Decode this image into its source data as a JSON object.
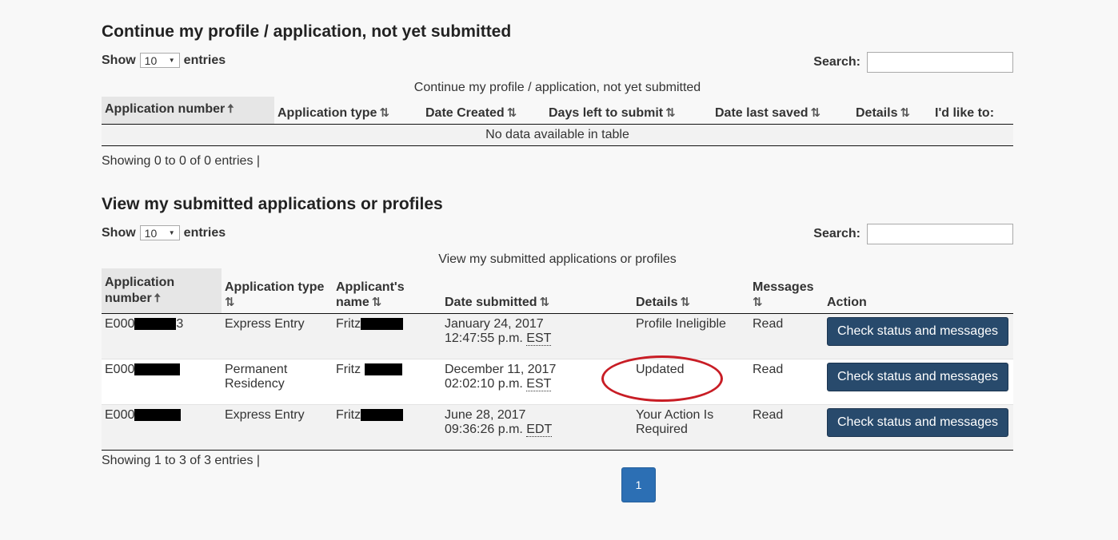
{
  "section1": {
    "title": "Continue my profile / application, not yet submitted",
    "show_label": "Show",
    "entries_label": "entries",
    "page_size": "10",
    "search_label": "Search:",
    "search_value": "",
    "caption": "Continue my profile / application, not yet submitted",
    "columns": [
      "Application number",
      "Application type",
      "Date Created",
      "Days left to submit",
      "Date last saved",
      "Details",
      "I'd like to:"
    ],
    "empty_message": "No data available in table",
    "info": "Showing 0 to 0 of 0 entries |"
  },
  "section2": {
    "title": "View my submitted applications or profiles",
    "show_label": "Show",
    "entries_label": "entries",
    "page_size": "10",
    "search_label": "Search:",
    "search_value": "",
    "caption": "View my submitted applications or profiles",
    "columns": {
      "app_number_1": "Application",
      "app_number_2": "number",
      "app_type": "Application type",
      "applicant_1": "Applicant's",
      "applicant_2": "name",
      "date_submitted": "Date submitted",
      "details": "Details",
      "messages": "Messages",
      "action": "Action"
    },
    "rows": [
      {
        "app_number_prefix": "E000",
        "app_number_suffix": "3",
        "app_type": "Express Entry",
        "applicant_name": "Fritz",
        "date": "January 24, 2017",
        "time": "12:47:55 p.m.",
        "tz": "EST",
        "details": "Profile Ineligible",
        "messages": "Read",
        "action": "Check status and messages"
      },
      {
        "app_number_prefix": "E000",
        "app_number_suffix": "",
        "app_type": "Permanent Residency",
        "applicant_name": "Fritz",
        "date": "December 11, 2017",
        "time": "02:02:10 p.m.",
        "tz": "EST",
        "details": "Updated",
        "messages": "Read",
        "action": "Check status and messages"
      },
      {
        "app_number_prefix": "E000",
        "app_number_suffix": "",
        "app_type": "Express Entry",
        "applicant_name": "Fritz",
        "date": "June 28, 2017",
        "time": "09:36:26 p.m.",
        "tz": "EDT",
        "details": "Your Action Is Required",
        "messages": "Read",
        "action": "Check status and messages"
      }
    ],
    "info": "Showing 1 to 3 of 3 entries |",
    "current_page": "1"
  },
  "icons": {
    "sort_asc": "arrow-up-icon",
    "sortable": "sort-arrows-icon",
    "dropdown": "caret-down-icon"
  },
  "colors": {
    "button": "#284a6c",
    "pager_active": "#2c6fb4",
    "highlight_circle": "#c81d25"
  }
}
